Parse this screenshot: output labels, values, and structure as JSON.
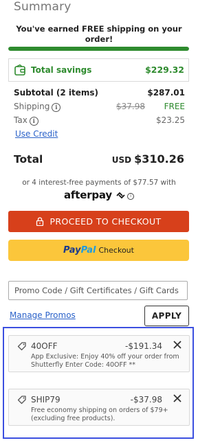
{
  "summary": {
    "title": "Summary",
    "shipping_message": "You've earned FREE shipping on your order!",
    "shipping_progress": 1.0,
    "total_savings_label": "Total savings",
    "total_savings_value": "$229.32",
    "subtotal_label": "Subtotal (2 items)",
    "subtotal_value": "$287.01",
    "shipping_label": "Shipping",
    "shipping_original": "$37.98",
    "shipping_value": "FREE",
    "tax_label": "Tax",
    "tax_value": "$23.25",
    "use_credit_label": "Use Credit",
    "total_label": "Total",
    "total_currency": "USD",
    "total_value": "$310.26",
    "installments_text": "or 4 interest-free payments of $77.57 with",
    "afterpay_label": "afterpay"
  },
  "buttons": {
    "checkout_label": "PROCEED TO CHECKOUT",
    "paypal_word1": "Pay",
    "paypal_word2": "Pal",
    "paypal_checkout": "Checkout",
    "apply_label": "APPLY",
    "manage_promos_label": "Manage Promos"
  },
  "promo_input": {
    "placeholder": "Promo Code / Gift Certificates / Gift Cards",
    "value": ""
  },
  "applied_promos": [
    {
      "code": "40OFF",
      "amount": "-$191.34",
      "description": "App Exclusive: Enjoy 40% off your order from Shutterfly Enter Code: 40OFF **"
    },
    {
      "code": "SHIP79",
      "amount": "-$37.98",
      "description": "Free economy shipping on orders of $79+ (excluding free products)."
    }
  ],
  "colors": {
    "accent_green": "#2e8b2e",
    "checkout_orange": "#d7401b",
    "paypal_yellow": "#fbc63b",
    "link_blue": "#2b62c9",
    "highlight_frame": "#3b4fe0"
  }
}
